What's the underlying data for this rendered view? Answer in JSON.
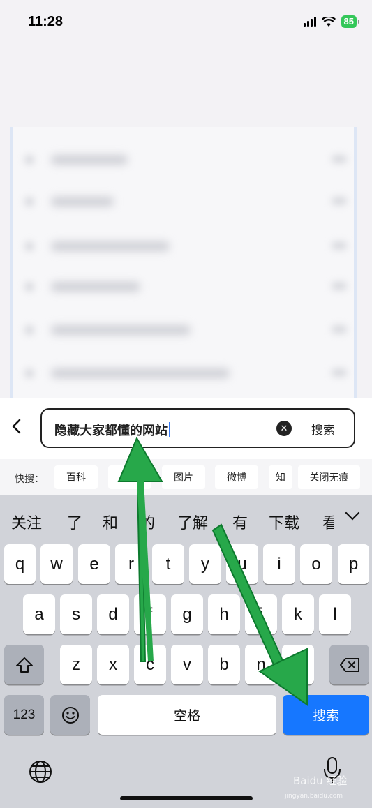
{
  "status_bar": {
    "time": "11:28",
    "battery": "85"
  },
  "search": {
    "query": "隐藏大家都懂的网站",
    "submit_label": "搜索"
  },
  "quick_search": {
    "label": "快搜：",
    "chips": [
      "百科",
      "视",
      "图片",
      "微博",
      "知",
      "关闭无痕"
    ]
  },
  "keyboard": {
    "candidates": [
      "关注",
      "了",
      "和",
      "的",
      "了解",
      "有",
      "下载",
      "看"
    ],
    "row1": [
      "q",
      "w",
      "e",
      "r",
      "t",
      "y",
      "u",
      "i",
      "o",
      "p"
    ],
    "row2": [
      "a",
      "s",
      "d",
      "f",
      "g",
      "h",
      "j",
      "k",
      "l"
    ],
    "row3": [
      "z",
      "x",
      "c",
      "v",
      "b",
      "n",
      "m"
    ],
    "numbers_key": "123",
    "space_key": "空格",
    "search_key": "搜索"
  },
  "watermark": {
    "text": "Baidu 经验",
    "sub": "jingyan.baidu.com"
  },
  "colors": {
    "accent": "#1677ff",
    "arrow": "#27a84a",
    "battery": "#33c759"
  },
  "icons": [
    "back-arrow-icon",
    "clear-icon",
    "shift-icon",
    "backspace-icon",
    "emoji-icon",
    "globe-icon",
    "mic-icon",
    "wifi-icon",
    "signal-icon",
    "battery-icon"
  ]
}
